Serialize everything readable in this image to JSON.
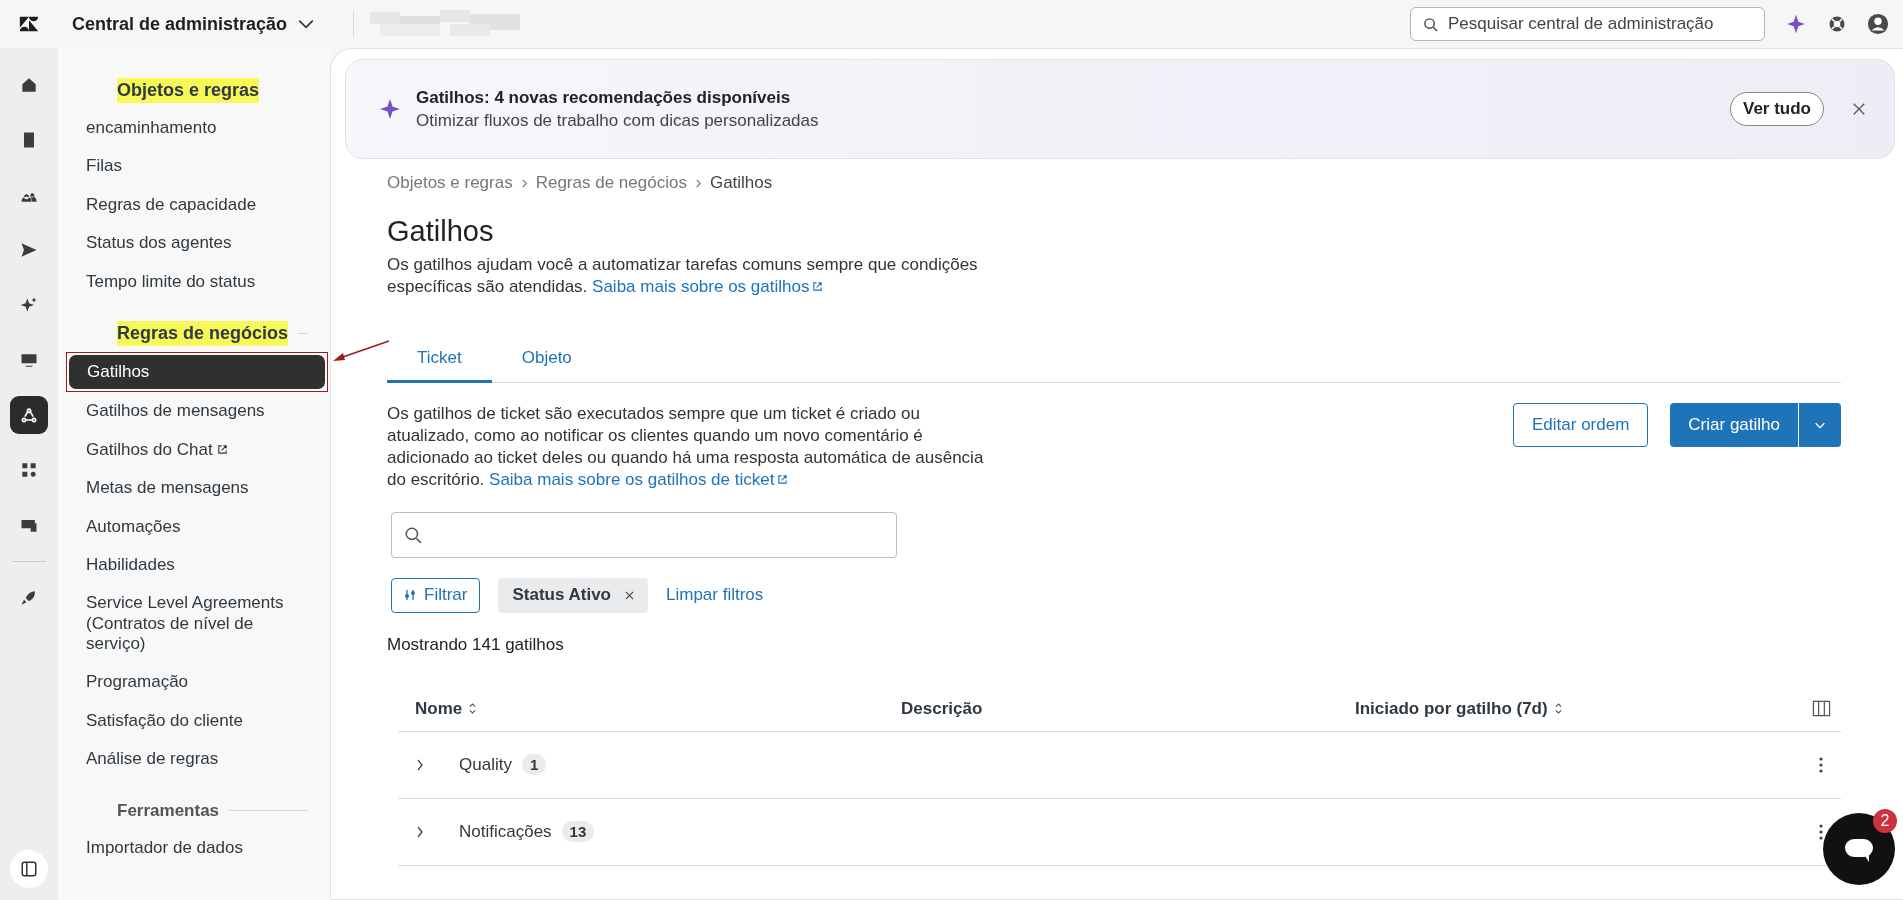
{
  "top_bar": {
    "product_menu": "Central de administração",
    "search": {
      "placeholder": "Pesquisar central de administração"
    }
  },
  "rail": [
    {
      "selected": false
    },
    {
      "selected": false
    },
    {
      "selected": false
    },
    {
      "selected": false
    },
    {
      "selected": false
    },
    {
      "selected": false
    },
    {
      "selected": true
    },
    {
      "selected": false
    },
    {
      "selected": false
    },
    {
      "selected": false
    }
  ],
  "sidebar": {
    "sections": [
      {
        "title": "Objetos e regras",
        "highlighted": true,
        "items": [
          {
            "label": "encaminhamento",
            "selected": false,
            "external": false,
            "marked": false
          },
          {
            "label": "Filas",
            "selected": false,
            "external": false,
            "marked": false
          },
          {
            "label": "Regras de capacidade",
            "selected": false,
            "external": false,
            "marked": false
          },
          {
            "label": "Status dos agentes",
            "selected": false,
            "external": false,
            "marked": false
          },
          {
            "label": "Tempo limite do status",
            "selected": false,
            "external": false,
            "marked": false
          }
        ]
      },
      {
        "title": "Regras de negócios",
        "highlighted": true,
        "items": [
          {
            "label": "Gatilhos",
            "selected": true,
            "external": false,
            "marked": true
          },
          {
            "label": "Gatilhos de mensagens",
            "selected": false,
            "external": false,
            "marked": false
          },
          {
            "label": "Gatilhos do Chat",
            "selected": false,
            "external": true,
            "marked": false
          },
          {
            "label": "Metas de mensagens",
            "selected": false,
            "external": false,
            "marked": false
          },
          {
            "label": "Automações",
            "selected": false,
            "external": false,
            "marked": false
          },
          {
            "label": "Habilidades",
            "selected": false,
            "external": false,
            "marked": false
          },
          {
            "label": "Service Level Agreements (Contratos de nível de serviço)",
            "selected": false,
            "external": false,
            "marked": false
          },
          {
            "label": "Programação",
            "selected": false,
            "external": false,
            "marked": false
          },
          {
            "label": "Satisfação do cliente",
            "selected": false,
            "external": false,
            "marked": false
          },
          {
            "label": "Análise de regras",
            "selected": false,
            "external": false,
            "marked": false
          }
        ]
      },
      {
        "title": "Ferramentas",
        "highlighted": false,
        "items": [
          {
            "label": "Importador de dados",
            "selected": false,
            "external": false,
            "marked": false
          }
        ]
      }
    ]
  },
  "banner": {
    "title": "Gatilhos: 4 novas recomendações disponíveis",
    "subtitle": "Otimizar fluxos de trabalho com dicas personalizadas",
    "action": "Ver tudo"
  },
  "breadcrumb": [
    "Objetos e regras",
    "Regras de negócios",
    "Gatilhos"
  ],
  "page": {
    "title": "Gatilhos",
    "description": "Os gatilhos ajudam você a automatizar tarefas comuns sempre que condições específicas são atendidas.",
    "link": "Saiba mais sobre os gatilhos"
  },
  "tabs": [
    {
      "label": "Ticket",
      "selected": true
    },
    {
      "label": "Objeto",
      "selected": false
    }
  ],
  "tab_panel": {
    "description": "Os gatilhos de ticket são executados sempre que um ticket é criado ou atualizado, como ao notificar os clientes quando um novo comentário é adicionado ao ticket deles ou quando há uma resposta automática de ausência do escritório.",
    "link": "Saiba mais sobre os gatilhos de ticket",
    "buttons": [
      {
        "label": "Editar ordem",
        "kind": "secondary"
      },
      {
        "label": "Criar gatilho",
        "kind": "split"
      }
    ]
  },
  "filters": {
    "button": "Filtrar",
    "chips": [
      "Status Ativo"
    ],
    "clear": "Limpar filtros"
  },
  "count": "Mostrando 141 gatilhos",
  "table": {
    "columns": [
      {
        "label": "Nome",
        "sortable": true
      },
      {
        "label": "Descrição",
        "sortable": false
      },
      {
        "label": "Iniciado por gatilho (7d)",
        "sortable": true
      }
    ],
    "rows": [
      {
        "name": "Quality",
        "count": "1",
        "expanded": false
      },
      {
        "name": "Notificações",
        "count": "13",
        "expanded": false
      }
    ]
  },
  "chat_widget": {
    "badge": "2"
  }
}
